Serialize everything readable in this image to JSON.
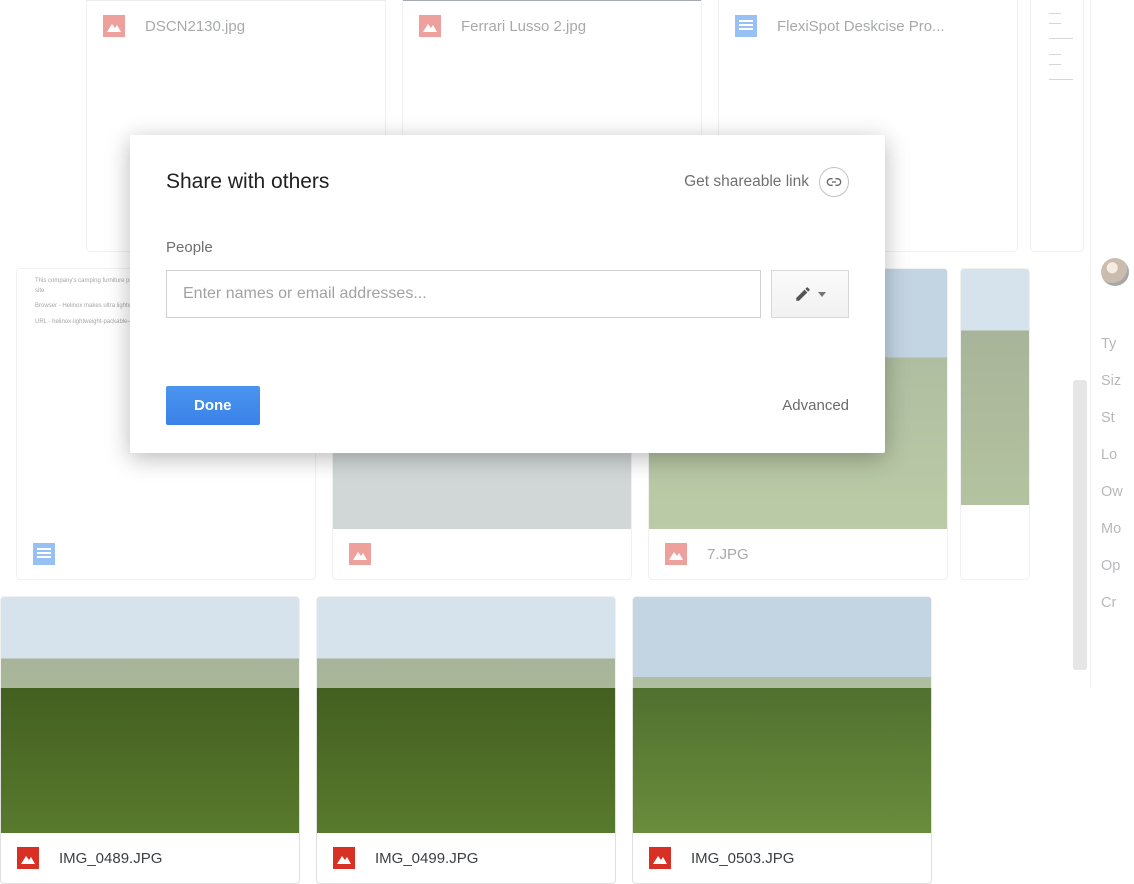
{
  "files": {
    "row1": [
      {
        "name": "DSCN2130.jpg",
        "type": "image"
      },
      {
        "name": "Ferrari Lusso 2.jpg",
        "type": "image"
      },
      {
        "name": "FlexiSpot Deskcise Pro...",
        "type": "doc"
      }
    ],
    "row2": [
      {
        "name": "",
        "type": "doc"
      },
      {
        "name": "",
        "type": "image"
      },
      {
        "name": "7.JPG",
        "type": "image"
      }
    ],
    "row3": [
      {
        "name": "IMG_0489.JPG",
        "type": "image"
      },
      {
        "name": "IMG_0499.JPG",
        "type": "image"
      },
      {
        "name": "IMG_0503.JPG",
        "type": "image"
      }
    ]
  },
  "side": {
    "items": [
      "Ty",
      "Siz",
      "St",
      "Lo",
      "Ow",
      "Mo",
      "Op",
      "Cr"
    ]
  },
  "dialog": {
    "title": "Share with others",
    "shareable_link_label": "Get shareable link",
    "people_label": "People",
    "people_placeholder": "Enter names or email addresses...",
    "done_label": "Done",
    "advanced_label": "Advanced"
  },
  "colors": {
    "primary": "#3b8cf0",
    "image_icon": "#d93025",
    "doc_icon": "#1a73e8"
  }
}
